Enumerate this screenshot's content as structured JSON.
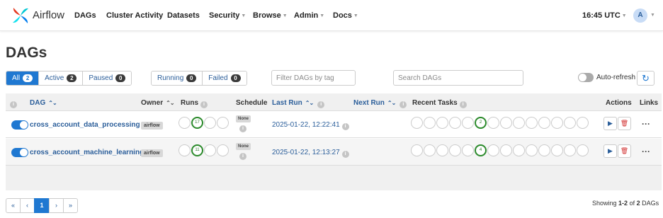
{
  "navbar": {
    "brand": "Airflow",
    "items": [
      {
        "label": "DAGs",
        "dropdown": false
      },
      {
        "label": "Cluster Activity",
        "dropdown": false
      },
      {
        "label": "Datasets",
        "dropdown": false
      },
      {
        "label": "Security",
        "dropdown": true
      },
      {
        "label": "Browse",
        "dropdown": true
      },
      {
        "label": "Admin",
        "dropdown": true
      },
      {
        "label": "Docs",
        "dropdown": true
      }
    ],
    "time": "16:45 UTC",
    "avatar_initial": "A"
  },
  "page_title": "DAGs",
  "filters": {
    "all": {
      "label": "All",
      "count": "2"
    },
    "active": {
      "label": "Active",
      "count": "2"
    },
    "paused": {
      "label": "Paused",
      "count": "0"
    },
    "running": {
      "label": "Running",
      "count": "0"
    },
    "failed": {
      "label": "Failed",
      "count": "0"
    }
  },
  "tag_filter_placeholder": "Filter DAGs by tag",
  "search_placeholder": "Search DAGs",
  "auto_refresh_label": "Auto-refresh",
  "columns": {
    "dag": "DAG",
    "owner": "Owner",
    "runs": "Runs",
    "schedule": "Schedule",
    "last_run": "Last Run",
    "next_run": "Next Run",
    "recent_tasks": "Recent Tasks",
    "actions": "Actions",
    "links": "Links"
  },
  "rows": [
    {
      "dag_id": "cross_account_data_processing",
      "owner": "airflow",
      "runs_success": "17",
      "schedule": "None",
      "last_run": "2025-01-22, 12:22:41",
      "recent_tasks_success": "2"
    },
    {
      "dag_id": "cross_account_machine_learning",
      "owner": "airflow",
      "runs_success": "11",
      "schedule": "None",
      "last_run": "2025-01-22, 12:13:27",
      "recent_tasks_success": "4"
    }
  ],
  "pagination": {
    "first": "«",
    "prev": "‹",
    "current": "1",
    "next": "›",
    "last": "»",
    "showing_prefix": "Showing",
    "showing_range": "1-2",
    "showing_of": "of",
    "showing_total": "2",
    "showing_suffix": "DAGs"
  },
  "colors": {
    "primary": "#1f78d1",
    "link": "#2b5e9a",
    "success": "#2b8a2b",
    "danger": "#d23232"
  }
}
